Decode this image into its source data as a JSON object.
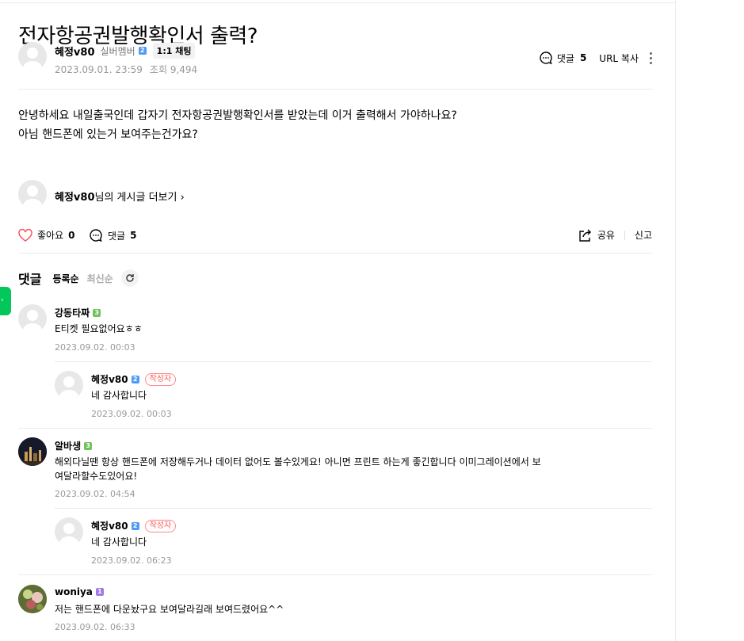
{
  "post": {
    "title": "전자항공권발행확인서 출력?",
    "author": {
      "nick": "혜정v80",
      "grade": "실버멤버",
      "level": "2",
      "chat_label": "1:1 채팅"
    },
    "date": "2023.09.01. 23:59",
    "views": "조회 9,494",
    "toolbar": {
      "comment_label": "댓글",
      "comment_count": "5",
      "url_copy": "URL 복사"
    },
    "content_lines": [
      "안녕하세요 내일출국인데 갑자기 전자항공권발행확인서를 받았는데 이거 출력해서 가야하나요?",
      "아님 핸드폰에 있는거 보여주는건가요?"
    ],
    "more_posts": {
      "nick": "혜정v80",
      "suffix": "님의 게시글 더보기",
      "chevron": "›"
    },
    "actions": {
      "like_label": "좋아요",
      "like_count": "0",
      "comment_label": "댓글",
      "comment_count": "5",
      "share_label": "공유",
      "report_label": "신고"
    }
  },
  "comments_section": {
    "title": "댓글",
    "sort_options": [
      "등록순",
      "최신순"
    ],
    "items": [
      {
        "nick": "강동타짜",
        "level": "3",
        "text": "E티켓 필요없어요ㅎㅎ",
        "date": "2023.09.02. 00:03",
        "reply": false,
        "writer": false
      },
      {
        "nick": "혜정v80",
        "level": "2",
        "writer_badge": "작성자",
        "text": "네 감사합니다",
        "date": "2023.09.02. 00:03",
        "reply": true,
        "writer": true
      },
      {
        "nick": "알바생",
        "level": "3",
        "text_lines": [
          "해외다닐땐 항상 핸드폰에 저장해두거나 데이터 없어도 볼수있게요! 아니면 프린트 하는게 좋긴합니다 이미그레이션에서 보",
          "여달라할수도있어요!"
        ],
        "date": "2023.09.02. 04:54",
        "reply": false,
        "writer": false
      },
      {
        "nick": "혜정v80",
        "level": "2",
        "writer_badge": "작성자",
        "text": "네 감사합니다",
        "date": "2023.09.02. 06:23",
        "reply": true,
        "writer": true
      },
      {
        "nick": "woniya",
        "level": "1",
        "text": "저는 핸드폰에 다운놨구요 보여달라길래 보여드렸어요^^",
        "date": "2023.09.02. 06:33",
        "reply": false,
        "writer": false
      }
    ]
  },
  "colors": {
    "accent_green": "#03c75a",
    "writer_red": "#ff5a5a",
    "level_blue": "#4f9bf6",
    "level_green": "#71c25b",
    "level_purple": "#a07ae6"
  },
  "icons": [
    "comment-icon",
    "more-vertical-icon",
    "heart-icon",
    "share-icon",
    "refresh-icon",
    "default-avatar-icon"
  ]
}
